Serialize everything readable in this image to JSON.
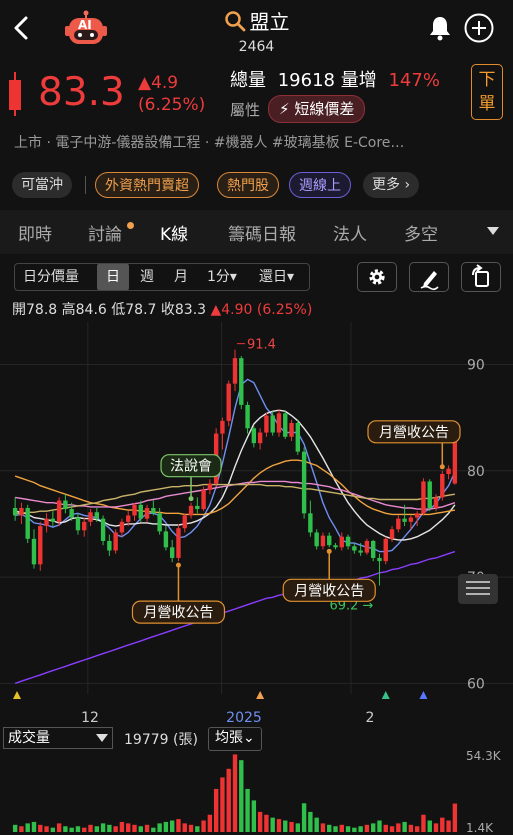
{
  "header": {
    "name": "盟立",
    "code": "2464",
    "ai_label": "AI"
  },
  "quote": {
    "price": "83.3",
    "change": "▲4.9",
    "change_pct": "(6.25%)",
    "volume_label": "總量",
    "volume_value": "19618",
    "volume_unit": "量增",
    "volume_pct": "147%",
    "attr_label": "屬性",
    "attr_badge": "短線價差",
    "order_label": "下單",
    "tags": "上市 · 電子中游-儀器設備工程 · #機器人 #玻璃基板 E-Core…"
  },
  "chips": [
    "可當沖",
    "外資熱門賣超",
    "熱門股",
    "週線上",
    "更多 ›"
  ],
  "tabs": [
    "即時",
    "討論",
    "K線",
    "籌碼日報",
    "法人",
    "多空"
  ],
  "toolbar": {
    "items": [
      "日分價量",
      "日",
      "週",
      "月",
      "1分▾",
      "還日▾"
    ]
  },
  "ohlc": {
    "open_label": "開",
    "open": "78.8",
    "high_label": "高",
    "high": "84.6",
    "low_label": "低",
    "low": "78.7",
    "close_label": "收",
    "close": "83.3",
    "change": "▲4.90 (6.25%)"
  },
  "chart_data": {
    "type": "candlestick",
    "y_ticks": [
      "90",
      "80",
      "70",
      "60"
    ],
    "ylim": [
      59,
      94
    ],
    "x_ticks": [
      "12",
      "2025",
      "2"
    ],
    "high_marker": "91.4",
    "low_marker": "69.2",
    "annotations": [
      "法說會",
      "月營收公告",
      "月營收公告",
      "月營收公告"
    ],
    "candles": [
      [
        76.5,
        77.5,
        75.3,
        75.8
      ],
      [
        75.8,
        77,
        75,
        76.5
      ],
      [
        76.5,
        76.8,
        73.2,
        73.6
      ],
      [
        73.6,
        74.5,
        70.8,
        71.2
      ],
      [
        71.2,
        75.2,
        70.6,
        74.8
      ],
      [
        74.8,
        76,
        74.2,
        75.5
      ],
      [
        75.5,
        76.2,
        74.8,
        75.2
      ],
      [
        75.2,
        77.5,
        74.8,
        77.2
      ],
      [
        77.2,
        77.8,
        76,
        76.4
      ],
      [
        76.4,
        77,
        75.3,
        75.6
      ],
      [
        75.6,
        76,
        74,
        74.4
      ],
      [
        74.4,
        75.6,
        73.8,
        75.2
      ],
      [
        75.2,
        76.4,
        74.8,
        76.1
      ],
      [
        76.1,
        76.5,
        75.2,
        75.5
      ],
      [
        75.5,
        75.8,
        73,
        73.4
      ],
      [
        73.4,
        74,
        72,
        72.5
      ],
      [
        72.5,
        74.5,
        72.2,
        74.2
      ],
      [
        74.2,
        75.5,
        73.8,
        75.2
      ],
      [
        75.2,
        76.2,
        74.8,
        75.8
      ],
      [
        75.8,
        77,
        75.3,
        76.8
      ],
      [
        76.8,
        77.2,
        75.2,
        75.5
      ],
      [
        75.5,
        76.8,
        75.2,
        76.5
      ],
      [
        76.5,
        77.2,
        75.8,
        76
      ],
      [
        76,
        76.5,
        74,
        74.3
      ],
      [
        74.3,
        74.8,
        72.5,
        72.8
      ],
      [
        72.8,
        73.5,
        71.4,
        71.8
      ],
      [
        71.8,
        75,
        71.5,
        74.6
      ],
      [
        74.6,
        76,
        74.2,
        75.8
      ],
      [
        75.8,
        77,
        75.5,
        76.7
      ],
      [
        76.7,
        77.5,
        76,
        76.4
      ],
      [
        76.4,
        78.5,
        76.2,
        78.2
      ],
      [
        78.2,
        79.2,
        77.8,
        78.8
      ],
      [
        78.8,
        84,
        78.5,
        83.5
      ],
      [
        83.5,
        85,
        82,
        84.7
      ],
      [
        84.7,
        88.5,
        84.2,
        88.2
      ],
      [
        88.2,
        91.4,
        87.5,
        90.6
      ],
      [
        90.6,
        90.8,
        85.8,
        86.2
      ],
      [
        86.2,
        86.5,
        83.5,
        84
      ],
      [
        84,
        84.2,
        82.2,
        82.6
      ],
      [
        82.6,
        84,
        82,
        83.6
      ],
      [
        83.6,
        85.5,
        83.2,
        85.2
      ],
      [
        85.2,
        85.6,
        83.3,
        83.6
      ],
      [
        83.6,
        85.8,
        83.2,
        85.4
      ],
      [
        85.4,
        85.6,
        83,
        83.2
      ],
      [
        83.2,
        84.8,
        82.8,
        84.5
      ],
      [
        84.5,
        84.8,
        81.5,
        81.8
      ],
      [
        81.8,
        82.2,
        75.5,
        76
      ],
      [
        76,
        77.2,
        73.8,
        74.2
      ],
      [
        74.2,
        74.5,
        72.6,
        72.9
      ],
      [
        72.9,
        74.2,
        72.6,
        73.9
      ],
      [
        73.9,
        74.2,
        72.8,
        73
      ],
      [
        73,
        73.2,
        72.6,
        72.8
      ],
      [
        72.8,
        74.2,
        72.5,
        73.8
      ],
      [
        73.8,
        74,
        72.6,
        72.9
      ],
      [
        72.9,
        73.2,
        72.2,
        72.5
      ],
      [
        72.5,
        73.2,
        72,
        72.3
      ],
      [
        72.3,
        73.6,
        72.1,
        73.4
      ],
      [
        73.4,
        73.5,
        71.5,
        71.8
      ],
      [
        71.8,
        72.2,
        69.2,
        71.5
      ],
      [
        71.5,
        73.8,
        71.2,
        73.6
      ],
      [
        73.6,
        74.8,
        73.3,
        74.5
      ],
      [
        74.5,
        75.8,
        74.2,
        75.5
      ],
      [
        75.5,
        76.8,
        74.8,
        75.2
      ],
      [
        75.2,
        75.8,
        74.5,
        75.6
      ],
      [
        75.6,
        76.2,
        74.8,
        76
      ],
      [
        76,
        79.3,
        75.8,
        79
      ],
      [
        79,
        79.2,
        76.2,
        76.5
      ],
      [
        76.5,
        77.8,
        76.2,
        77.5
      ],
      [
        77.5,
        80,
        77.2,
        79.7
      ],
      [
        79.7,
        80.5,
        79.2,
        80.2
      ],
      [
        78.8,
        84.6,
        78.7,
        83.3
      ]
    ],
    "ma_lines": [
      {
        "color": "#6f8ff2",
        "values": [
          75.8,
          75.9,
          75.6,
          75.1,
          75.0,
          74.9,
          74.7,
          74.9,
          75.4,
          75.9,
          76.0,
          75.8,
          75.7,
          75.6,
          75.1,
          74.6,
          74.0,
          73.8,
          74.2,
          74.9,
          75.5,
          76.0,
          76.0,
          75.8,
          75.1,
          74.3,
          73.7,
          73.8,
          74.2,
          74.8,
          75.7,
          76.8,
          78.5,
          80.7,
          83.2,
          85.9,
          88.1,
          88.6,
          88.3,
          87.1,
          85.9,
          85.2,
          84.2,
          83.6,
          83.6,
          83.6,
          82.5,
          80.7,
          78.9,
          77.0,
          75.6,
          74.6,
          73.5,
          73.2,
          73.2,
          73.0,
          72.8,
          72.7,
          72.4,
          72.4,
          72.5,
          73.1,
          73.8,
          74.5,
          75.3,
          76.1,
          76.4,
          76.9,
          77.8,
          78.6,
          79.9
        ]
      },
      {
        "color": "#e6e6e6",
        "values": [
          76.2,
          76.1,
          75.9,
          75.6,
          75.5,
          75.4,
          75.3,
          75.1,
          75.2,
          75.5,
          75.6,
          75.5,
          75.5,
          75.4,
          75.2,
          74.9,
          74.8,
          74.9,
          75.0,
          75.0,
          75.1,
          75.1,
          75.0,
          75.0,
          74.9,
          74.9,
          74.9,
          75.0,
          75.1,
          75.3,
          75.6,
          76.0,
          76.6,
          77.5,
          78.8,
          80.4,
          81.9,
          83.2,
          84.4,
          85.0,
          85.4,
          85.6,
          85.7,
          85.6,
          85.2,
          84.7,
          84.0,
          83.2,
          82.2,
          81.2,
          80.1,
          79.0,
          78.0,
          77.0,
          76.2,
          75.5,
          74.9,
          74.5,
          74.1,
          73.8,
          73.6,
          73.5,
          73.5,
          73.6,
          73.8,
          74.1,
          74.4,
          74.9,
          75.4,
          76.0,
          76.8
        ]
      },
      {
        "color": "#f1a33f",
        "values": [
          79.5,
          79.3,
          79.1,
          78.9,
          78.6,
          78.4,
          78.2,
          78.0,
          77.8,
          77.6,
          77.4,
          77.2,
          77.0,
          76.9,
          76.8,
          76.6,
          76.5,
          76.4,
          76.3,
          76.3,
          76.2,
          76.2,
          76.1,
          76.1,
          76.0,
          76.0,
          76.0,
          75.9,
          75.9,
          75.9,
          75.9,
          76.0,
          76.2,
          76.5,
          76.9,
          77.5,
          78.1,
          78.7,
          79.3,
          79.8,
          80.2,
          80.5,
          80.7,
          80.9,
          81.0,
          81.0,
          80.9,
          80.7,
          80.5,
          80.1,
          79.7,
          79.2,
          78.7,
          78.1,
          77.6,
          77.1,
          76.7,
          76.4,
          76.2,
          76.0,
          75.9,
          75.9,
          75.9,
          75.9,
          75.9,
          75.9,
          75.9,
          76.0,
          76.1,
          76.2,
          76.3
        ]
      },
      {
        "color": "#e88ad0",
        "values": [
          77.5,
          77.4,
          77.3,
          77.2,
          77.1,
          77.0,
          77.0,
          76.9,
          76.8,
          76.8,
          76.7,
          76.7,
          76.6,
          76.6,
          76.6,
          76.6,
          76.6,
          76.7,
          76.8,
          76.9,
          77.0,
          77.2,
          77.3,
          77.4,
          77.6,
          77.7,
          77.8,
          77.9,
          78.0,
          78.1,
          78.2,
          78.3,
          78.4,
          78.5,
          78.6,
          78.7,
          78.8,
          78.9,
          78.9,
          79.0,
          79.0,
          79.0,
          79.0,
          79.0,
          78.9,
          78.9,
          78.8,
          78.8,
          78.7,
          78.6,
          78.5,
          78.3,
          78.2,
          78.0,
          77.8,
          77.6,
          77.4,
          77.2,
          77.0,
          76.8,
          76.7,
          76.6,
          76.5,
          76.5,
          76.4,
          76.4,
          76.4,
          76.5,
          76.6,
          76.8,
          77.0
        ]
      },
      {
        "color": "#c9b36a",
        "values": [
          76.0,
          76.0,
          76.1,
          76.1,
          76.2,
          76.2,
          76.3,
          76.4,
          76.5,
          76.6,
          76.7,
          76.8,
          76.9,
          77.0,
          77.2,
          77.3,
          77.4,
          77.6,
          77.7,
          77.8,
          78.0,
          78.1,
          78.2,
          78.3,
          78.4,
          78.5,
          78.5,
          78.6,
          78.6,
          78.6,
          78.7,
          78.7,
          78.7,
          78.7,
          78.7,
          78.7,
          78.7,
          78.7,
          78.7,
          78.7,
          78.6,
          78.6,
          78.6,
          78.5,
          78.5,
          78.4,
          78.3,
          78.3,
          78.2,
          78.1,
          78.0,
          77.9,
          77.8,
          77.7,
          77.6,
          77.5,
          77.4,
          77.4,
          77.3,
          77.3,
          77.3,
          77.3,
          77.3,
          77.3,
          77.3,
          77.4,
          77.4,
          77.5,
          77.6,
          77.7,
          77.8
        ]
      },
      {
        "color": "#8a3dff",
        "values": [
          60.0,
          60.2,
          60.4,
          60.6,
          60.8,
          61.0,
          61.2,
          61.4,
          61.6,
          61.8,
          62.0,
          62.2,
          62.4,
          62.6,
          62.8,
          63.0,
          63.2,
          63.4,
          63.6,
          63.8,
          64.0,
          64.2,
          64.4,
          64.6,
          64.8,
          65.0,
          65.2,
          65.4,
          65.6,
          65.8,
          66.0,
          66.2,
          66.4,
          66.6,
          66.8,
          67.0,
          67.2,
          67.4,
          67.6,
          67.8,
          68.0,
          68.1,
          68.3,
          68.4,
          68.5,
          68.6,
          68.7,
          68.8,
          68.9,
          69.0,
          69.2,
          69.3,
          69.4,
          69.6,
          69.7,
          69.9,
          70.0,
          70.2,
          70.4,
          70.5,
          70.7,
          70.8,
          71.0,
          71.2,
          71.3,
          71.5,
          71.7,
          71.8,
          72.0,
          72.2,
          72.4
        ]
      }
    ],
    "volume": {
      "current": "19779 (張)",
      "label": "成交量",
      "mode": "均張",
      "max_label": "54.3K",
      "min_label": "1.4K",
      "ylim": [
        0,
        54.3
      ],
      "values": [
        5,
        4,
        6,
        7,
        5,
        4,
        3,
        6,
        4,
        3,
        4,
        3,
        5,
        4,
        6,
        5,
        4,
        7,
        6,
        5,
        4,
        5,
        3,
        6,
        7,
        8,
        9,
        6,
        5,
        4,
        8,
        12,
        30,
        38,
        44,
        54,
        50,
        30,
        22,
        14,
        12,
        10,
        9,
        8,
        7,
        6,
        20,
        14,
        10,
        6,
        5,
        4,
        5,
        4,
        3,
        4,
        5,
        6,
        8,
        5,
        4,
        6,
        7,
        5,
        4,
        12,
        8,
        6,
        10,
        8,
        19.8
      ]
    }
  }
}
